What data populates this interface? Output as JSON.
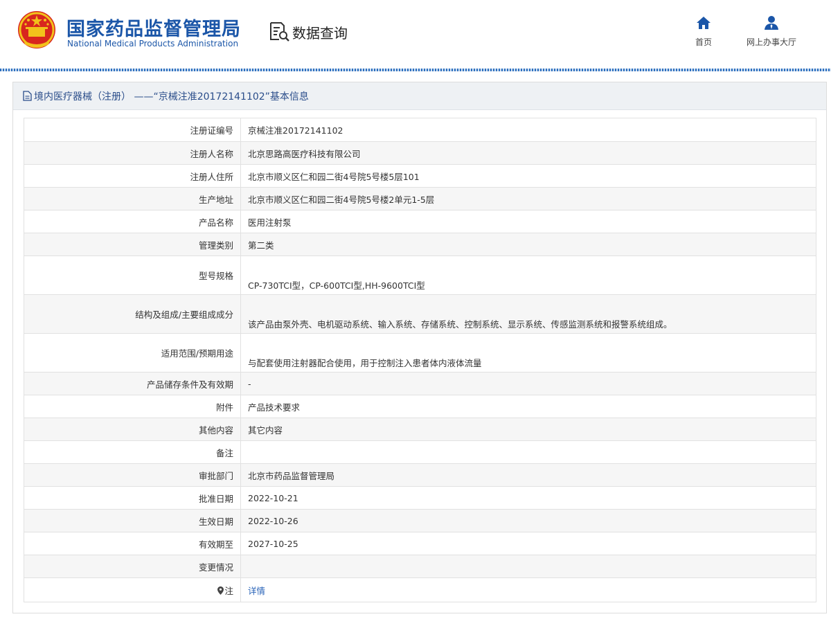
{
  "header": {
    "brand_cn": "国家药品监督管理局",
    "brand_en": "National Medical Products Administration",
    "emblem_icon": "national-emblem-icon",
    "data_query": {
      "icon": "document-search-icon",
      "label": "数据查询"
    },
    "nav": [
      {
        "icon": "home-icon",
        "label": "首页"
      },
      {
        "icon": "user-icon",
        "label": "网上办事大厅"
      }
    ]
  },
  "panel": {
    "icon": "document-icon",
    "title": "境内医疗器械（注册） ——“京械注准20172141102”基本信息"
  },
  "rows": [
    {
      "label": "注册证编号",
      "value": "京械注准20172141102"
    },
    {
      "label": "注册人名称",
      "value": "北京思路高医疗科技有限公司"
    },
    {
      "label": "注册人住所",
      "value": "北京市顺义区仁和园二街4号院5号楼5层101"
    },
    {
      "label": "生产地址",
      "value": "北京市顺义区仁和园二街4号院5号楼2单元1-5层"
    },
    {
      "label": "产品名称",
      "value": "医用注射泵"
    },
    {
      "label": "管理类别",
      "value": "第二类"
    },
    {
      "label": "型号规格",
      "value": "CP-730TCI型，CP-600TCI型,HH-9600TCI型"
    },
    {
      "label": "结构及组成/主要组成成分",
      "value": "该产品由泵外壳、电机驱动系统、输入系统、存储系统、控制系统、显示系统、传感监测系统和报警系统组成。"
    },
    {
      "label": "适用范围/预期用途",
      "value": "与配套使用注射器配合使用，用于控制注入患者体内液体流量"
    },
    {
      "label": "产品储存条件及有效期",
      "value": "-"
    },
    {
      "label": "附件",
      "value": "产品技术要求"
    },
    {
      "label": "其他内容",
      "value": "其它内容"
    },
    {
      "label": "备注",
      "value": ""
    },
    {
      "label": "审批部门",
      "value": "北京市药品监督管理局"
    },
    {
      "label": "批准日期",
      "value": "2022-10-21"
    },
    {
      "label": "生效日期",
      "value": "2022-10-26"
    },
    {
      "label": "有效期至",
      "value": "2027-10-25"
    },
    {
      "label": "变更情况",
      "value": ""
    },
    {
      "label": "注",
      "value": "详情",
      "icon": "map-pin-icon"
    }
  ],
  "colors": {
    "brand_blue": "#1b56a8",
    "link_blue": "#2a64b8",
    "panel_head_bg": "#eef1f4"
  }
}
